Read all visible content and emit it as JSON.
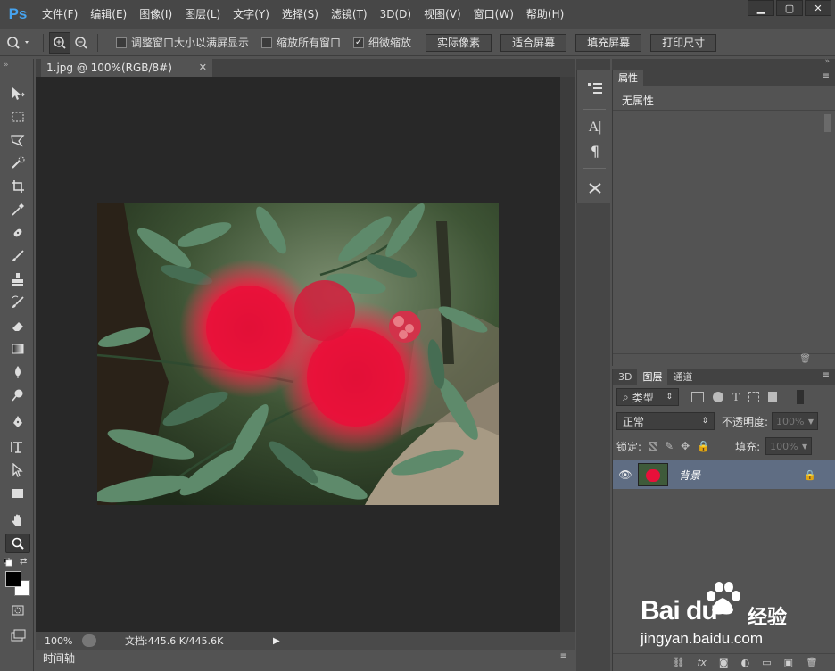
{
  "app": {
    "logo": "Ps"
  },
  "menu": [
    "文件(F)",
    "编辑(E)",
    "图像(I)",
    "图层(L)",
    "文字(Y)",
    "选择(S)",
    "滤镜(T)",
    "3D(D)",
    "视图(V)",
    "窗口(W)",
    "帮助(H)"
  ],
  "window_controls": [
    "minimize-icon",
    "restore-icon",
    "close-icon"
  ],
  "options": {
    "chk_resize": {
      "label": "调整窗口大小以满屏显示",
      "checked": false
    },
    "chk_zoom_all": {
      "label": "缩放所有窗口",
      "checked": false
    },
    "chk_scrubby": {
      "label": "细微缩放",
      "checked": true
    },
    "btn_actual": "实际像素",
    "btn_fit": "适合屏幕",
    "btn_fill": "填充屏幕",
    "btn_print": "打印尺寸"
  },
  "document": {
    "tab_title": "1.jpg @ 100%(RGB/8#)"
  },
  "status": {
    "zoom": "100%",
    "doc_size": "文档:445.6 K/445.6K"
  },
  "timeline": {
    "label": "时间轴"
  },
  "properties": {
    "tab": "属性",
    "body": "无属性"
  },
  "layers_panel": {
    "tabs": [
      "3D",
      "图层",
      "通道"
    ],
    "filter": "类型",
    "blend_mode": "正常",
    "opacity_label": "不透明度:",
    "opacity_value": "100%",
    "lock_label": "锁定:",
    "fill_label": "填充:",
    "fill_value": "100%",
    "layers": [
      {
        "name": "背景",
        "visible": true,
        "locked": true
      }
    ]
  },
  "watermark": {
    "brand": "Bai du",
    "cn": "经验",
    "url": "jingyan.baidu.com"
  }
}
